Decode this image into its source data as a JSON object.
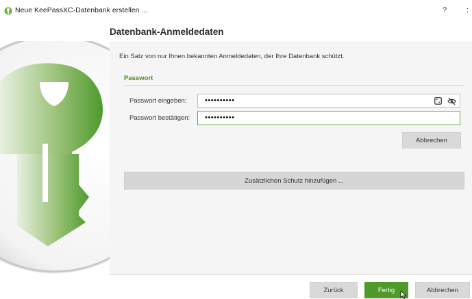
{
  "window": {
    "title": "Neue KeePassXC-Datenbank erstellen ...",
    "help_label": "?",
    "close_label": ":"
  },
  "page": {
    "heading": "Datenbank-Anmeldedaten",
    "description": "Ein Satz von nur Ihnen bekannten Anmeldedaten, der Ihre Datenbank schützt."
  },
  "password_group": {
    "title": "Passwort",
    "enter_label": "Passwort eingeben:",
    "enter_value": "••••••••••",
    "confirm_label": "Passwort bestätigen:",
    "confirm_value": "••••••••••",
    "cancel_label": "Abbrechen"
  },
  "additional_protection_label": "Zusätzlichen Schutz hinzufügen ...",
  "footer": {
    "back_label": "Zurück",
    "finish_label": "Fertig",
    "cancel_label": "Abbrechen"
  },
  "colors": {
    "accent_green": "#4e9a2a",
    "group_title_green": "#4e8a20"
  },
  "icons": [
    "keepassxc-app-icon",
    "password-generator-icon",
    "toggle-visibility-icon",
    "keepassxc-key-logo",
    "mouse-cursor-icon"
  ]
}
